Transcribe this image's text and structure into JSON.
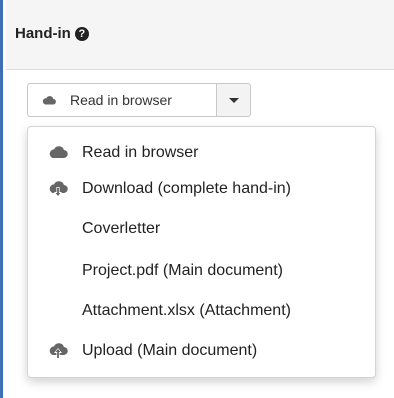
{
  "panel": {
    "title": "Hand-in",
    "help_glyph": "?"
  },
  "button": {
    "label": "Read in browser",
    "icon": "cloud-icon"
  },
  "menu": {
    "items": [
      {
        "label": "Read in browser",
        "icon": "cloud-icon"
      },
      {
        "label": "Download (complete hand-in)",
        "icon": "cloud-download-icon"
      },
      {
        "label": "Coverletter",
        "icon": ""
      },
      {
        "label": "Project.pdf (Main document)",
        "icon": ""
      },
      {
        "label": "Attachment.xlsx (Attachment)",
        "icon": ""
      },
      {
        "label": "Upload (Main document)",
        "icon": "cloud-upload-icon"
      }
    ]
  },
  "colors": {
    "accent": "#3d6fb6",
    "icon": "#666666"
  }
}
